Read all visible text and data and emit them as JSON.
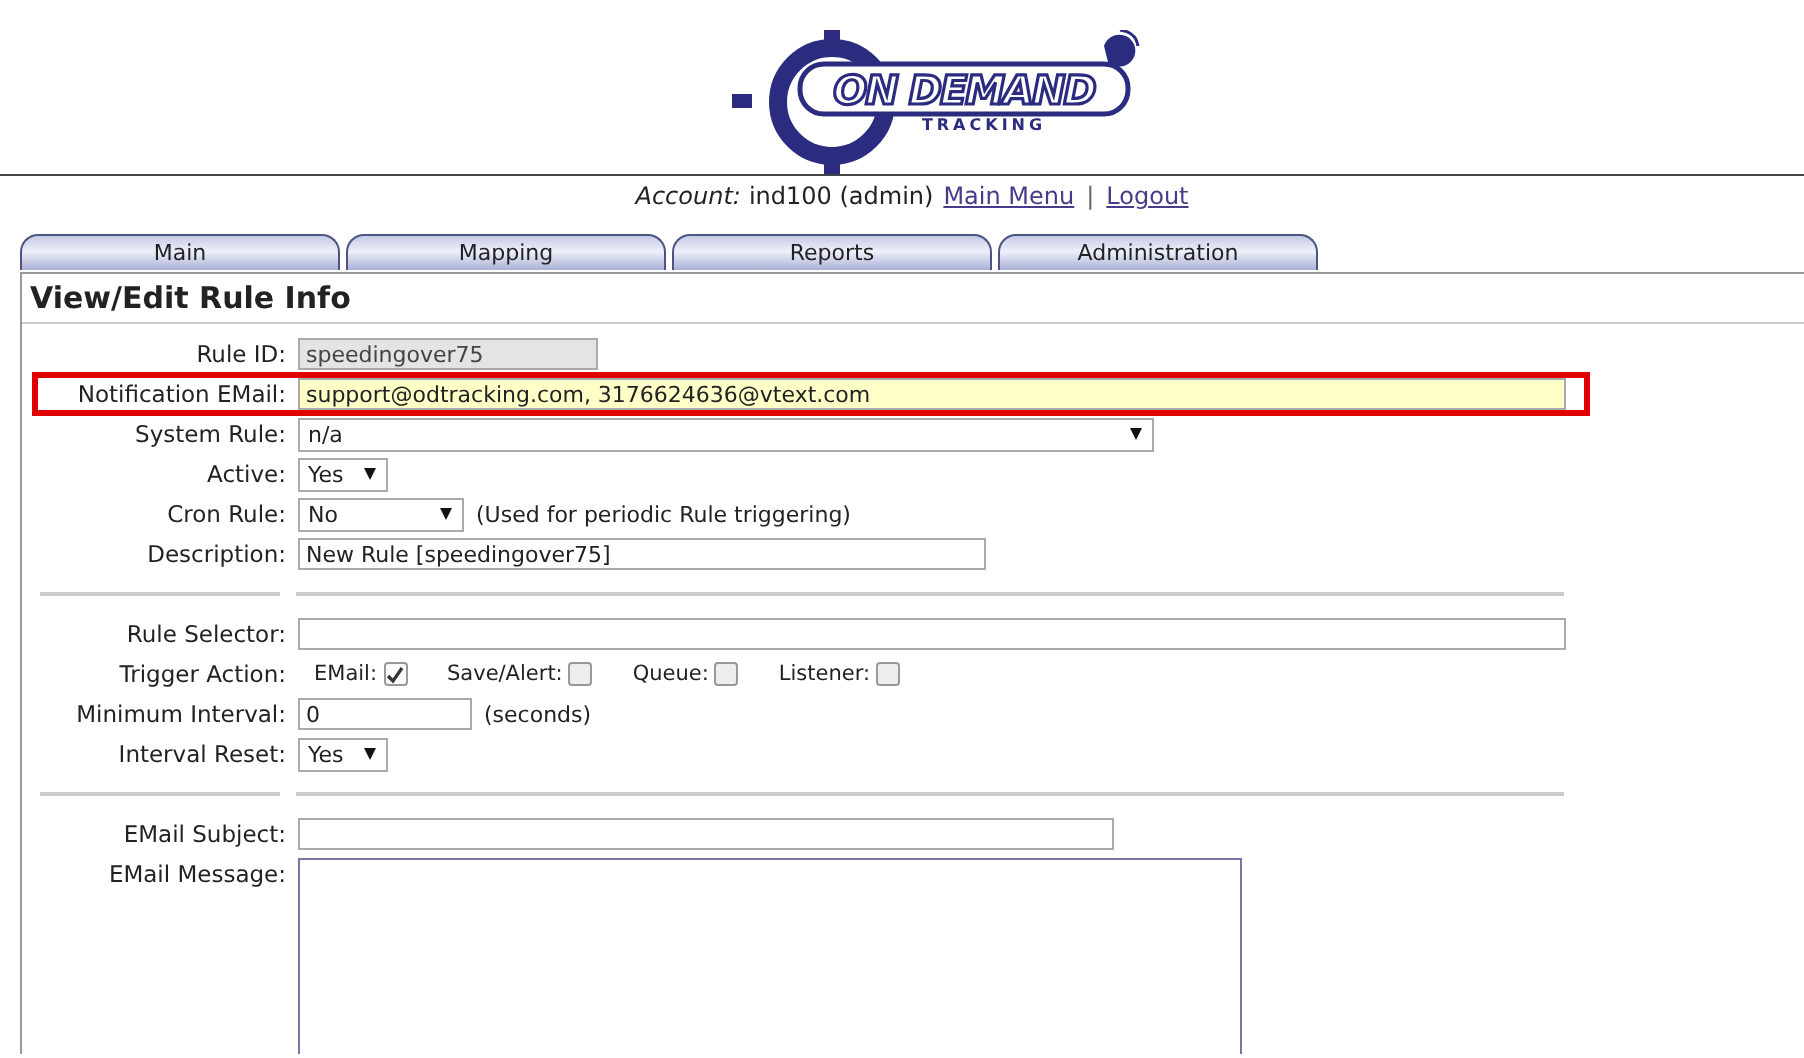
{
  "logo": {
    "name": "ON DEMAND",
    "tagline": "TRACKING"
  },
  "account": {
    "label": "Account:",
    "value": "ind100 (admin)",
    "links": [
      "Main Menu",
      "Logout"
    ],
    "separator": "|"
  },
  "tabs": [
    {
      "label": "Main",
      "selected": false
    },
    {
      "label": "Mapping",
      "selected": false
    },
    {
      "label": "Reports",
      "selected": false
    },
    {
      "label": "Administration",
      "selected": false
    }
  ],
  "title": "View/Edit Rule Info",
  "fields": [
    {
      "kind": "text",
      "label": "Rule ID:",
      "value": "speedingover75",
      "disabled": true
    },
    {
      "kind": "text",
      "label": "Notification EMail:",
      "value": "support@odtracking.com, 3176624636@vtext.com",
      "disabled": false,
      "highlighted": true
    },
    {
      "kind": "select",
      "label": "System Rule:",
      "value": "n/a"
    },
    {
      "kind": "select",
      "label": "Active:",
      "value": "Yes"
    },
    {
      "kind": "select",
      "label": "Cron Rule:",
      "value": "No",
      "note": "(Used for periodic Rule triggering)"
    },
    {
      "kind": "text",
      "label": "Description:",
      "value": "New Rule [speedingover75]",
      "disabled": false
    },
    {
      "kind": "separator"
    },
    {
      "kind": "text",
      "label": "Rule Selector:",
      "disabled": false
    },
    {
      "kind": "checkboxes",
      "label": "Trigger Action:",
      "options": [
        {
          "label": "EMail:",
          "checked": true
        },
        {
          "label": "Save/Alert:",
          "checked": false
        },
        {
          "label": "Queue:",
          "checked": false
        },
        {
          "label": "Listener:",
          "checked": false
        }
      ]
    },
    {
      "kind": "text",
      "label": "Minimum Interval:",
      "value": "0",
      "note": "(seconds)",
      "disabled": false
    },
    {
      "kind": "select",
      "label": "Interval Reset:",
      "value": "Yes"
    },
    {
      "kind": "separator"
    },
    {
      "kind": "text",
      "label": "EMail Subject:",
      "disabled": false
    },
    {
      "kind": "textarea",
      "label": "EMail Message:"
    }
  ]
}
